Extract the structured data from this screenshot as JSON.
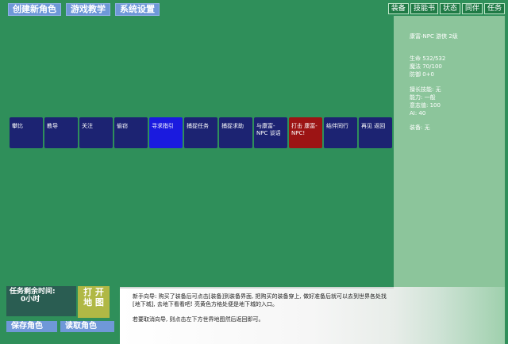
{
  "top_menu": [
    "创建新角色",
    "游戏教学",
    "系统设置"
  ],
  "tabs": [
    "装备",
    "技能书",
    "状态",
    "同伴",
    "任务"
  ],
  "panel": {
    "char_line": "康富-NPC 游侠 2级",
    "hp": "生命 532/532",
    "mp": "魔法 70/100",
    "def": "防御 0+0",
    "skill": "擅长技能: 无",
    "ability": "能力: 一般",
    "will": "意志值: 100",
    "ai": "AI: 40",
    "equip": "装备: 无"
  },
  "actions": [
    {
      "label": "攀比",
      "style": "normal"
    },
    {
      "label": "教导",
      "style": "normal"
    },
    {
      "label": "关注",
      "style": "normal"
    },
    {
      "label": "偷窃",
      "style": "normal"
    },
    {
      "label": "寻求指引",
      "style": "blue"
    },
    {
      "label": "捕捉任务",
      "style": "normal"
    },
    {
      "label": "捕捉求助",
      "style": "normal"
    },
    {
      "label": "与康富-NPC 谈话",
      "style": "normal"
    },
    {
      "label": "打击 康富-NPC!",
      "style": "red"
    },
    {
      "label": "结伴同行",
      "style": "normal"
    },
    {
      "label": "再见 返回",
      "style": "normal"
    }
  ],
  "task": {
    "title": "任务剩余时间:",
    "value": "0小时"
  },
  "map_button": [
    "打 开",
    "地 图"
  ],
  "bottom": {
    "save": "保存角色",
    "load": "读取角色"
  },
  "hint": {
    "p1": "新手向导: 购买了装备后可点击[装备]到装备界面, 把购买的装备穿上, 做好准备后就可以去到世界各处找[地下城], 去地下看看吧! 亮黄色方格处便是地下城的入口。",
    "p2": "若要取消向导, 则点击左下方世界地图然后返回即可。"
  }
}
